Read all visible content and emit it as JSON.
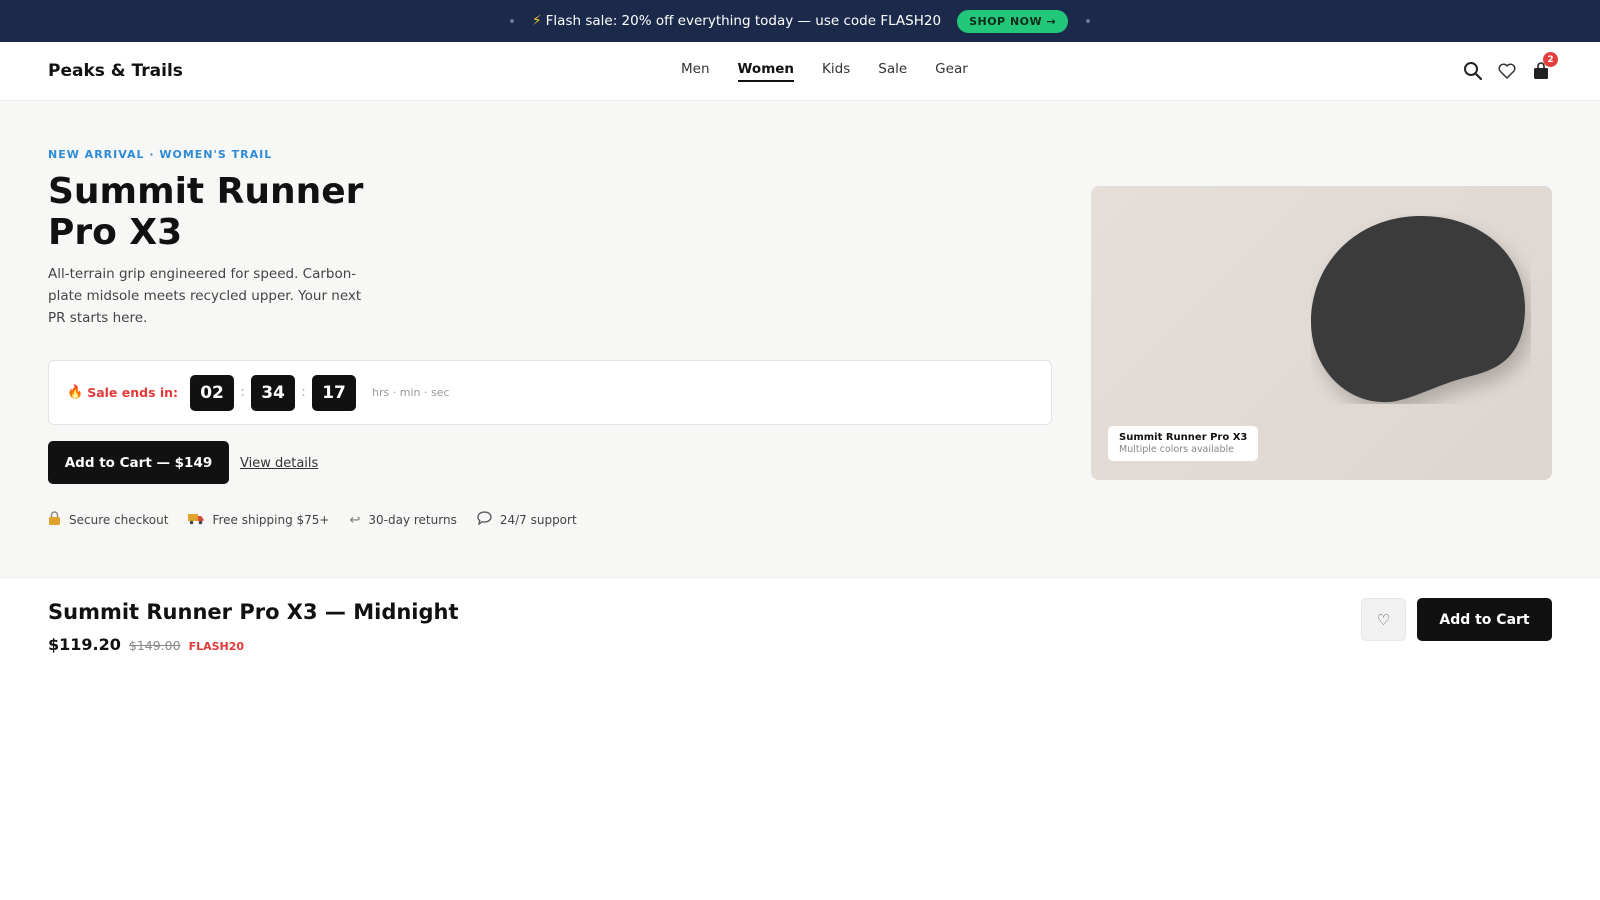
{
  "promo": {
    "bolt_icon": "⚡",
    "text": "Flash sale: 20% off everything today — use code FLASH20",
    "button_label": "SHOP NOW →"
  },
  "header": {
    "logo": "Peaks & Trails",
    "nav": [
      "Men",
      "Women",
      "Kids",
      "Sale",
      "Gear"
    ],
    "active_nav": "Women",
    "icons": {
      "search": "search-icon",
      "wishlist": "heart-icon",
      "cart": "shopping-bag-icon"
    },
    "cart_count": "2"
  },
  "hero": {
    "eyebrow": "NEW ARRIVAL · WOMEN'S TRAIL",
    "title": "Summit Runner Pro X3",
    "description": "All-terrain grip engineered for speed. Carbon-plate midsole meets recycled upper. Your next PR starts here.",
    "countdown": {
      "label": "Sale ends in:",
      "hours": "02",
      "minutes": "34",
      "seconds": "17",
      "separator": ":",
      "units": "hrs · min · sec"
    },
    "add_to_cart_label": "Add to Cart — $149",
    "view_details_label": "View details",
    "trust": [
      {
        "icon": "lock-icon",
        "label": "Secure checkout"
      },
      {
        "icon": "truck-icon",
        "label": "Free shipping $75+"
      },
      {
        "icon": "return-arrow-icon",
        "label": "30-day returns"
      },
      {
        "icon": "chat-bubble-icon",
        "label": "24/7 support"
      }
    ],
    "product_card": {
      "caption_title": "Summit Runner Pro X3",
      "caption_sub": "Multiple colors available"
    }
  },
  "sticky": {
    "title": "Summit Runner Pro X3 — Midnight",
    "sale_price": "$119.20",
    "original_price": "$149.00",
    "promo_code": "FLASH20",
    "add_to_cart_label": "Add to Cart"
  },
  "colors": {
    "promo_bg": "#1b2a4a",
    "promo_button": "#22c77a",
    "accent_blue": "#2e8bd6",
    "sale_red": "#e23a3a",
    "primary_button": "#111111"
  }
}
